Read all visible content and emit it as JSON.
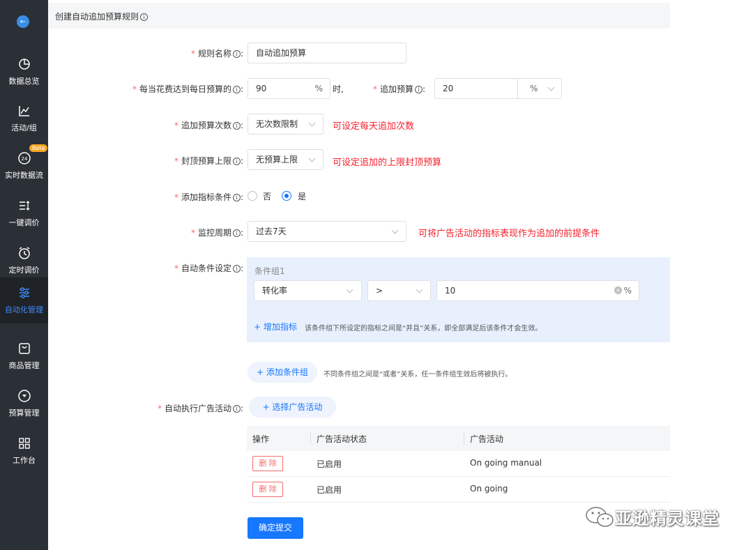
{
  "sidebar": {
    "items": [
      {
        "label": "数据总览",
        "icon": "pie-chart-icon"
      },
      {
        "label": "活动/组",
        "icon": "line-chart-icon"
      },
      {
        "label": "实时数据流",
        "icon": "clock-24-icon",
        "badge": "Beta"
      },
      {
        "label": "一键调价",
        "icon": "sort-list-icon"
      },
      {
        "label": "定时调价",
        "icon": "alarm-clock-icon"
      },
      {
        "label": "自动化管理",
        "icon": "sliders-icon",
        "active": true
      },
      {
        "label": "商品管理",
        "icon": "product-box-icon"
      },
      {
        "label": "预算管理",
        "icon": "budget-coin-icon"
      },
      {
        "label": "工作台",
        "icon": "grid-icon"
      }
    ]
  },
  "header": {
    "title": "创建自动追加预算规则"
  },
  "form": {
    "rule_name": {
      "label": "规则名称",
      "value": "自动追加预算"
    },
    "spend_ratio": {
      "label": "每当花费达到每日预算的",
      "value": "90",
      "unit": "%",
      "suffix": "时,"
    },
    "add_budget": {
      "label": "追加预算",
      "value": "20",
      "unit": "%"
    },
    "add_times": {
      "label": "追加预算次数",
      "value": "无次数限制",
      "note": "可设定每天追加次数"
    },
    "cap": {
      "label": "封顶预算上限",
      "value": "无预算上限",
      "note": "可设定追加的上限封顶预算"
    },
    "add_metric": {
      "label": "添加指标条件",
      "option_no": "否",
      "option_yes": "是",
      "selected": "是"
    },
    "period": {
      "label": "监控周期",
      "value": "过去7天",
      "note": "可将广告活动的指标表现作为追加的前提条件"
    },
    "auto_cond": {
      "label": "自动条件设定",
      "group_title": "条件组1",
      "metric": "转化率",
      "operator": ">",
      "threshold": "10",
      "threshold_unit": "%",
      "add_metric_link": "+ 增加指标",
      "group_hint": "该条件组下所设定的指标之间是“并且”关系，即全部满足后该条件才会生效。"
    },
    "add_group": {
      "label": "+ 添加条件组",
      "hint": "不同条件组之间是“或者”关系，任一条件组生效后将被执行。"
    },
    "campaigns": {
      "label": "自动执行广告活动",
      "select_button": "+ 选择广告活动"
    }
  },
  "table": {
    "headers": [
      "操作",
      "广告活动状态",
      "广告活动"
    ],
    "rows": [
      {
        "action": "删 除",
        "status": "已启用",
        "campaign": "On going manual"
      },
      {
        "action": "删 除",
        "status": "已启用",
        "campaign": "On going"
      }
    ]
  },
  "submit_label": "确定提交",
  "watermark": "亚逊精灵课堂",
  "colors": {
    "primary": "#1677ff",
    "danger": "#f5222d",
    "sidebar": "#2b2f36"
  }
}
